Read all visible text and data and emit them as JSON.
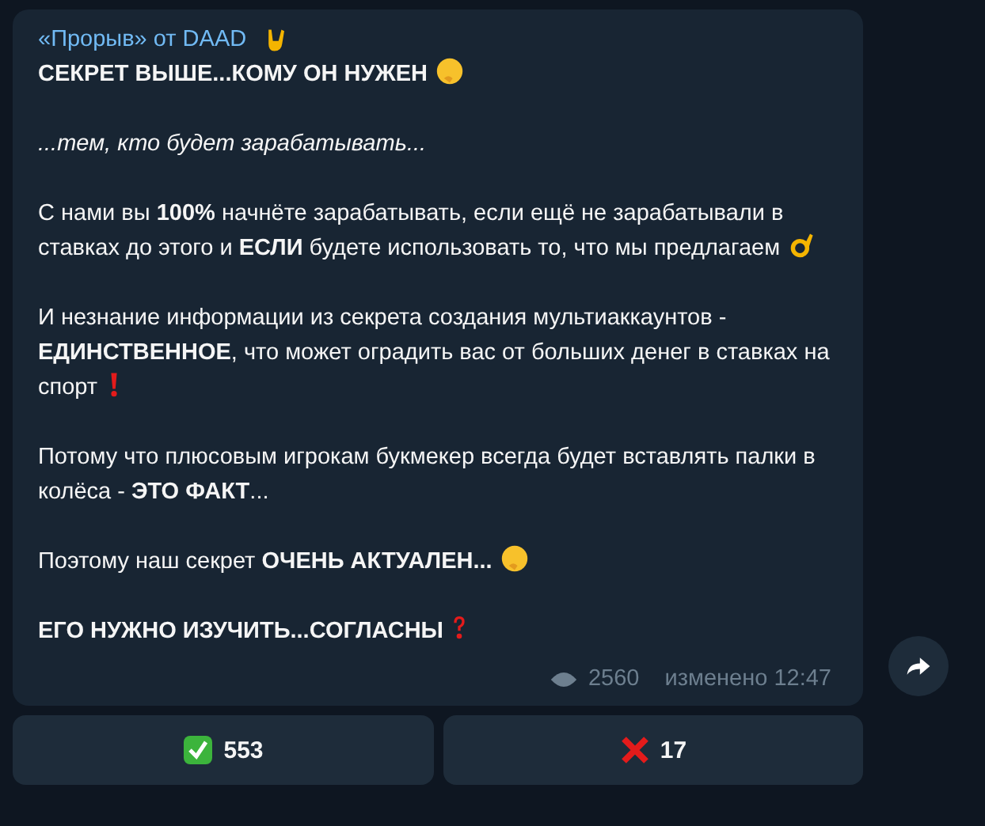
{
  "message": {
    "channel": "«Прорыв» от DAAD",
    "paragraphs": [
      "**СЕКРЕТ ВЫШЕ...КОМУ ОН НУЖЕН**",
      "...тем, кто будет зарабатывать...",
      "С нами вы **100%** начнёте зарабатывать, если ещё не зарабатывали в ставках до этого и **ЕСЛИ** будете использовать то, что мы предлагаем",
      "И незнание информации из секрета создания мультиаккаунтов - **ЕДИНСТВЕННОЕ**, что может оградить вас от больших денег в ставках на спорт",
      "Потому что плюсовым игрокам букмекер всегда будет вставлять палки в колёса - **ЭТО ФАКТ**...",
      "Поэтому наш секрет **ОЧЕНЬ АКТУАЛЕН...**",
      "**ЕГО НУЖНО ИЗУЧИТЬ...СОГЛАСНЫ**"
    ],
    "views": "2560",
    "edited": "изменено 12:47"
  },
  "reactions": [
    {
      "count": "553"
    },
    {
      "count": "17"
    }
  ]
}
